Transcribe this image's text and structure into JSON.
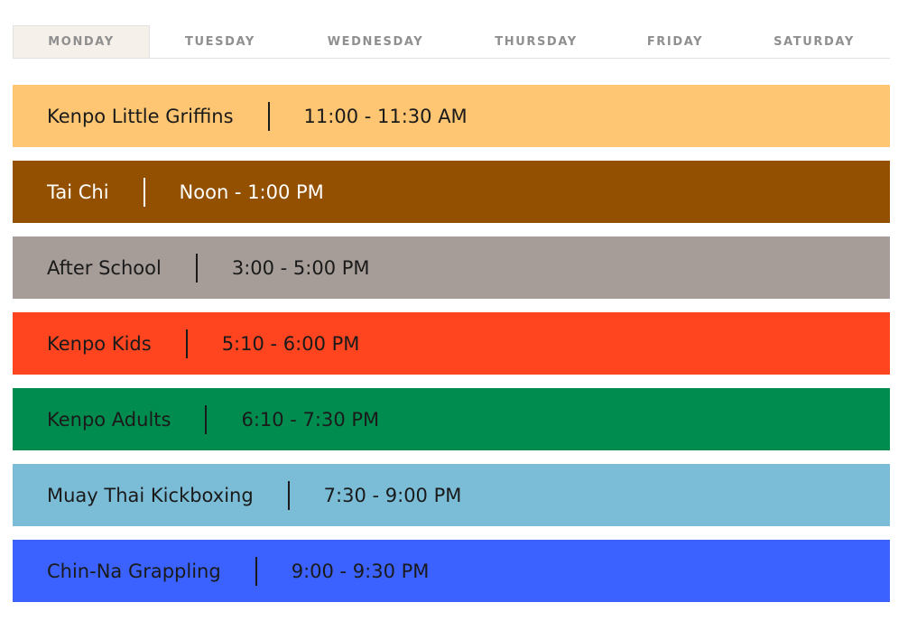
{
  "tabs": [
    {
      "label": "MONDAY",
      "active": true
    },
    {
      "label": "TUESDAY",
      "active": false
    },
    {
      "label": "WEDNESDAY",
      "active": false
    },
    {
      "label": "THURSDAY",
      "active": false
    },
    {
      "label": "FRIDAY",
      "active": false
    },
    {
      "label": "SATURDAY",
      "active": false
    }
  ],
  "classes": [
    {
      "name": "Kenpo Little Griffins",
      "time": "11:00 - 11:30 AM",
      "color": "#fec672",
      "text_color": "#1a1a1a"
    },
    {
      "name": "Tai Chi",
      "time": "Noon - 1:00 PM",
      "color": "#935000",
      "text_color": "#ffffff"
    },
    {
      "name": "After School",
      "time": "3:00 - 5:00 PM",
      "color": "#a69d98",
      "text_color": "#1a1a1a"
    },
    {
      "name": "Kenpo Kids",
      "time": "5:10 - 6:00 PM",
      "color": "#ff4520",
      "text_color": "#1a1a1a"
    },
    {
      "name": "Kenpo Adults",
      "time": "6:10 - 7:30 PM",
      "color": "#008c4e",
      "text_color": "#1a1a1a"
    },
    {
      "name": "Muay Thai Kickboxing",
      "time": "7:30 - 9:00 PM",
      "color": "#7bbdd7",
      "text_color": "#1a1a1a"
    },
    {
      "name": "Chin-Na Grappling",
      "time": "9:00 - 9:30 PM",
      "color": "#3b62ff",
      "text_color": "#1a1a1a"
    }
  ]
}
